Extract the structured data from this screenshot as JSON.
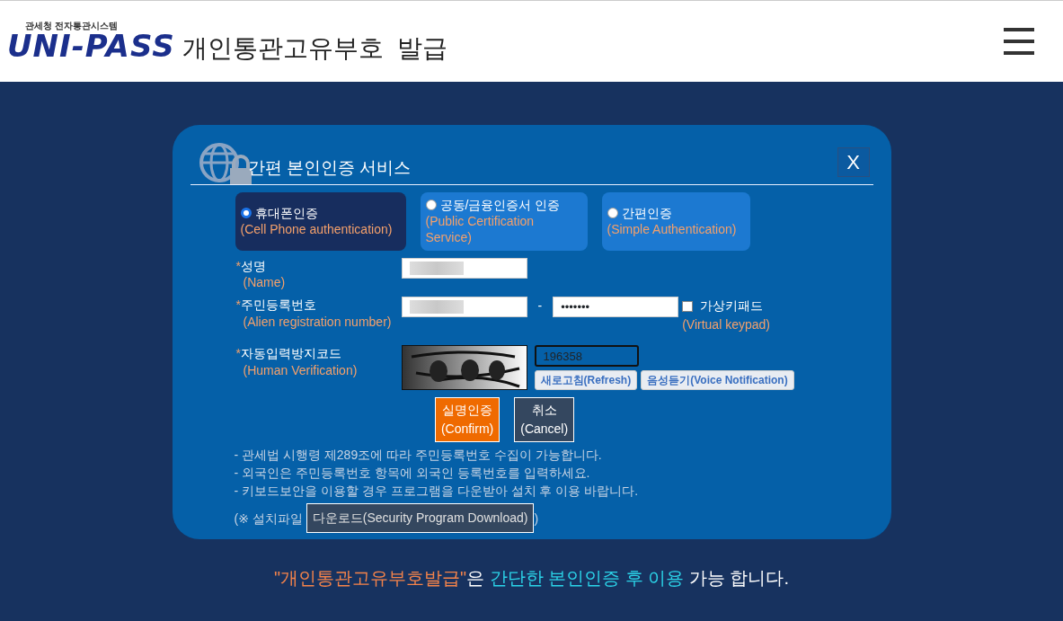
{
  "header": {
    "logo_caption": "관세청 전자통관시스템",
    "logo_text": "UNI-PASS",
    "title": "개인통관고유부호  발급"
  },
  "dialog": {
    "title": "간편 본인인증 서비스",
    "close_label": "X",
    "auth_options": [
      {
        "label": "휴대폰인증",
        "sublabel": "(Cell Phone authentication)",
        "selected": true
      },
      {
        "label": "공동/금융인증서 인증",
        "sublabel": "(Public Certification Service)",
        "selected": false
      },
      {
        "label": "간편인증",
        "sublabel": "(Simple Authentication)",
        "selected": false
      }
    ],
    "fields": [
      {
        "kind": "name",
        "required_mark": "*",
        "label": "성명",
        "sublabel": "(Name)"
      },
      {
        "kind": "idnumber",
        "required_mark": "*",
        "label": "주민등록번호",
        "sublabel": "(Alien registration number)",
        "separator": "-",
        "second_value": "•••••••",
        "keypad_label": "가상키패드",
        "keypad_sublabel": "(Virtual keypad)",
        "keypad_checked": false
      },
      {
        "kind": "captcha",
        "required_mark": "*",
        "label": "자동입력방지코드",
        "sublabel": "(Human Verification)",
        "value": "196358",
        "refresh_label": "새로고침(Refresh)",
        "voice_label": "음성듣기(Voice Notification)"
      }
    ],
    "buttons": [
      {
        "kind": "confirm",
        "label": "실명인증",
        "sublabel": "(Confirm)"
      },
      {
        "kind": "cancel",
        "label": "취소",
        "sublabel": "(Cancel)"
      }
    ],
    "notes": [
      "- 관세법 시행령 제289조에 따라 주민등록번호 수집이 가능합니다.",
      "- 외국인은 주민등록번호 항목에 외국인 등록번호를 입력하세요.",
      "- 키보드보안을 이용할 경우 프로그램을 다운받아 설치 후 이용 바랍니다."
    ],
    "download": {
      "prefix": "(※ 설치파일",
      "button_label": "다운로드(Security Program Download)",
      "suffix": ")"
    }
  },
  "footer_message": [
    {
      "kind": "quote",
      "text": "\"개인통관고유부호발급\""
    },
    {
      "kind": "plain",
      "text": "은 "
    },
    {
      "kind": "emphasis",
      "text": "간단한 본인인증 후 이용"
    },
    {
      "kind": "plain",
      "text": " 가능 합니다."
    }
  ]
}
